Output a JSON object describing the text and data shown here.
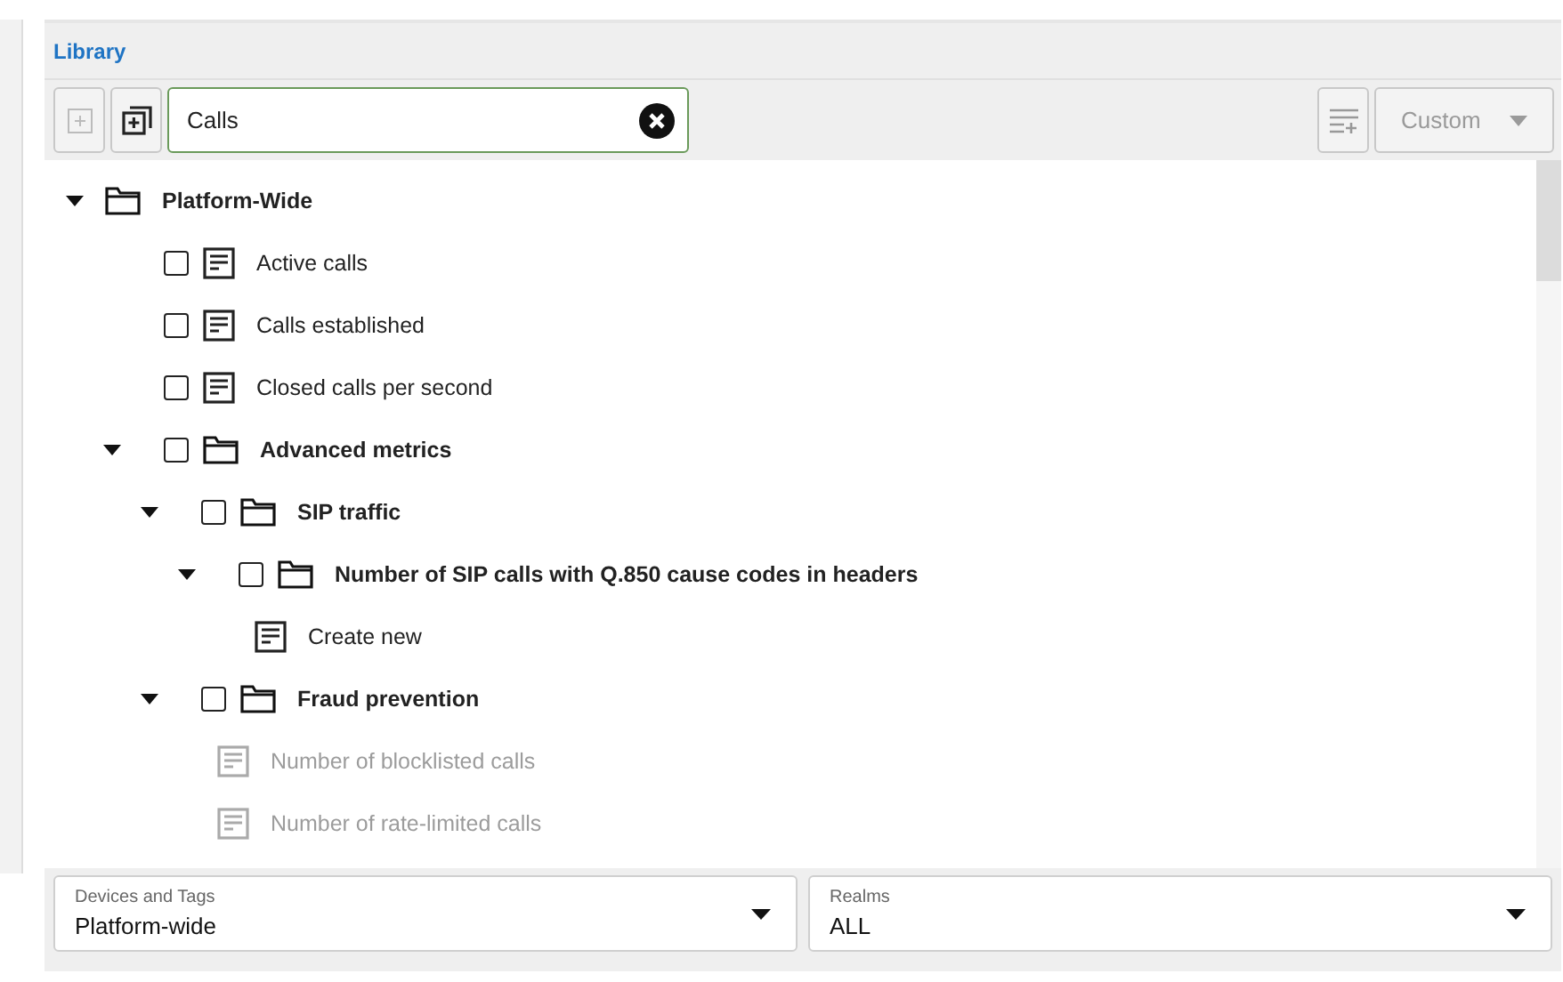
{
  "panel": {
    "title": "Library"
  },
  "toolbar": {
    "search": {
      "value": "Calls"
    },
    "view_select": {
      "value": "Custom",
      "disabled": true
    }
  },
  "tree": [
    {
      "kind": "folder",
      "label": "Platform-Wide",
      "expanded": true,
      "children": [
        {
          "kind": "metric",
          "label": "Active calls",
          "checked": false,
          "disabled": false
        },
        {
          "kind": "metric",
          "label": "Calls established",
          "checked": false,
          "disabled": false
        },
        {
          "kind": "metric",
          "label": "Closed calls per second",
          "checked": false,
          "disabled": false
        },
        {
          "kind": "folder",
          "label": "Advanced metrics",
          "checked": false,
          "expanded": true,
          "children": [
            {
              "kind": "folder",
              "label": "SIP traffic",
              "checked": false,
              "expanded": true,
              "children": [
                {
                  "kind": "folder",
                  "label": "Number of SIP calls with Q.850 cause codes in headers",
                  "checked": false,
                  "expanded": true,
                  "children": [
                    {
                      "kind": "metric",
                      "label": "Create new",
                      "disabled": false
                    }
                  ]
                }
              ]
            },
            {
              "kind": "folder",
              "label": "Fraud prevention",
              "checked": false,
              "expanded": true,
              "children": [
                {
                  "kind": "metric",
                  "label": "Number of blocklisted calls",
                  "disabled": true
                },
                {
                  "kind": "metric",
                  "label": "Number of rate-limited calls",
                  "disabled": true
                }
              ]
            }
          ]
        }
      ]
    }
  ],
  "filters": [
    {
      "label": "Devices and Tags",
      "value": "Platform-wide"
    },
    {
      "label": "Realms",
      "value": "ALL"
    }
  ]
}
